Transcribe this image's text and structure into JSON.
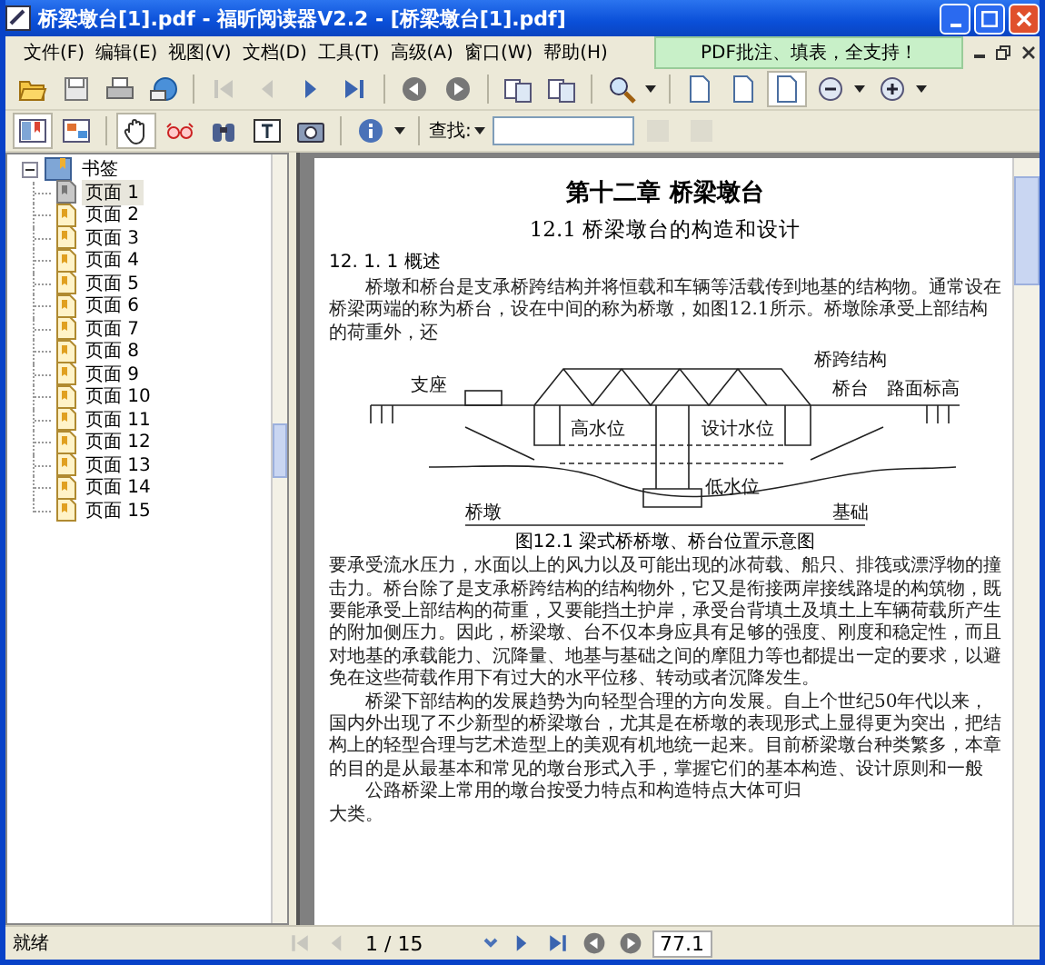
{
  "window": {
    "title": "桥梁墩台[1].pdf - 福昕阅读器V2.2 - [桥梁墩台[1].pdf]"
  },
  "menu": [
    {
      "label": "文件(F)"
    },
    {
      "label": "编辑(E)"
    },
    {
      "label": "视图(V)"
    },
    {
      "label": "文档(D)"
    },
    {
      "label": "工具(T)"
    },
    {
      "label": "高级(A)"
    },
    {
      "label": "窗口(W)"
    },
    {
      "label": "帮助(H)"
    }
  ],
  "promo_banner": "PDF批注、填表，全支持！",
  "toolbar_main": [
    {
      "kind": "open",
      "selected": false,
      "disabled": false
    },
    {
      "kind": "save",
      "selected": false,
      "disabled": false
    },
    {
      "kind": "print",
      "selected": false,
      "disabled": false
    },
    {
      "kind": "email",
      "selected": false,
      "disabled": false
    },
    {
      "kind": "sep"
    },
    {
      "kind": "first",
      "selected": false,
      "disabled": true
    },
    {
      "kind": "prev",
      "selected": false,
      "disabled": true
    },
    {
      "kind": "next",
      "selected": false,
      "disabled": false
    },
    {
      "kind": "last",
      "selected": false,
      "disabled": false
    },
    {
      "kind": "sep"
    },
    {
      "kind": "back",
      "selected": false,
      "disabled": false
    },
    {
      "kind": "forward",
      "selected": false,
      "disabled": false
    },
    {
      "kind": "sep"
    },
    {
      "kind": "rotate",
      "selected": false,
      "disabled": false
    },
    {
      "kind": "rotate",
      "selected": false,
      "disabled": false
    },
    {
      "kind": "sep"
    },
    {
      "kind": "zoom",
      "selected": false,
      "disabled": false
    },
    {
      "kind": "caret"
    },
    {
      "kind": "sep"
    },
    {
      "kind": "page",
      "selected": false,
      "disabled": false
    },
    {
      "kind": "page",
      "selected": false,
      "disabled": false
    },
    {
      "kind": "page",
      "selected": true,
      "disabled": false
    },
    {
      "kind": "zoomout",
      "selected": false,
      "disabled": false
    },
    {
      "kind": "caret"
    },
    {
      "kind": "zoomin",
      "selected": false,
      "disabled": false
    },
    {
      "kind": "caret"
    }
  ],
  "toolbar_tools": [
    {
      "kind": "bookmarks",
      "selected": true,
      "disabled": false
    },
    {
      "kind": "thumbs",
      "selected": false,
      "disabled": false
    },
    {
      "kind": "sep"
    },
    {
      "kind": "hand",
      "selected": true,
      "disabled": false
    },
    {
      "kind": "glasses",
      "selected": false,
      "disabled": false
    },
    {
      "kind": "binoculars",
      "selected": false,
      "disabled": false
    },
    {
      "kind": "textselect",
      "selected": false,
      "disabled": false
    },
    {
      "kind": "camera",
      "selected": false,
      "disabled": false
    },
    {
      "kind": "sep"
    },
    {
      "kind": "info",
      "selected": false,
      "disabled": false
    },
    {
      "kind": "caret"
    },
    {
      "kind": "sep"
    }
  ],
  "search": {
    "label": "查找:"
  },
  "search_buttons": [
    {
      "disabled": true
    },
    {
      "disabled": true
    }
  ],
  "bookmarks": {
    "label": "书签",
    "expanded": true,
    "children": [
      {
        "label": "页面 1",
        "selected": true
      },
      {
        "label": "页面 2",
        "selected": false
      },
      {
        "label": "页面 3",
        "selected": false
      },
      {
        "label": "页面 4",
        "selected": false
      },
      {
        "label": "页面 5",
        "selected": false
      },
      {
        "label": "页面 6",
        "selected": false
      },
      {
        "label": "页面 7",
        "selected": false
      },
      {
        "label": "页面 8",
        "selected": false
      },
      {
        "label": "页面 9",
        "selected": false
      },
      {
        "label": "页面 10",
        "selected": false
      },
      {
        "label": "页面 11",
        "selected": false
      },
      {
        "label": "页面 12",
        "selected": false
      },
      {
        "label": "页面 13",
        "selected": false
      },
      {
        "label": "页面 14",
        "selected": false
      },
      {
        "label": "页面 15",
        "selected": false
      }
    ]
  },
  "document": {
    "chapter_title": "第十二章  桥梁墩台",
    "section_title": "12.1  桥梁墩台的构造和设计",
    "subsection_title": "12. 1. 1  概述",
    "paragraph_1": "桥墩和桥台是支承桥跨结构并将恒载和车辆等活载传到地基的结构物。通常设在桥梁两端的称为桥台，设在中间的称为桥墩，如图12.1所示。桥墩除承受上部结构的荷重外，还",
    "diagram_labels": [
      "桥跨结构",
      "支座",
      "桥台",
      "路面标高",
      "高水位",
      "设计水位",
      "低水位",
      "桥墩",
      "基础"
    ],
    "figure_caption": "图12.1   梁式桥桥墩、桥台位置示意图",
    "paragraphs": [
      "要承受流水压力，水面以上的风力以及可能出现的冰荷载、船只、排筏或漂浮物的撞击力。桥台除了是支承桥跨结构的结构物外，它又是衔接两岸接线路堤的构筑物，既要能承受上部结构的荷重，又要能挡土护岸，承受台背填土及填土上车辆荷载所产生的附加侧压力。因此，桥梁墩、台不仅本身应具有足够的强度、刚度和稳定性，而且对地基的承载能力、沉降量、地基与基础之间的摩阻力等也都提出一定的要求，以避免在这些荷载作用下有过大的水平位移、转动或者沉降发生。",
      "桥梁下部结构的发展趋势为向轻型合理的方向发展。自上个世纪50年代以来，国内外出现了不少新型的桥梁墩台，尤其是在桥墩的表现形式上显得更为突出，把结构上的轻型合理与艺术造型上的美观有机地统一起来。目前桥梁墩台种类繁多，本章的目的是从最基本和常见的墩台形式入手，掌握它们的基本构造、设计原则和一般",
      "公路桥梁上常用的墩台按受力特点和构造特点大体可归",
      "大类。"
    ]
  },
  "status_bar": {
    "text": "就绪",
    "page_field": "1 / 15",
    "zoom_field": "77.1",
    "nav": [
      {
        "kind": "first",
        "disabled": true
      },
      {
        "kind": "prev",
        "disabled": true
      },
      {
        "kind": "field"
      },
      {
        "kind": "next",
        "disabled": false
      },
      {
        "kind": "last",
        "disabled": false
      },
      {
        "kind": "back",
        "disabled": false
      },
      {
        "kind": "forward",
        "disabled": false
      }
    ]
  }
}
